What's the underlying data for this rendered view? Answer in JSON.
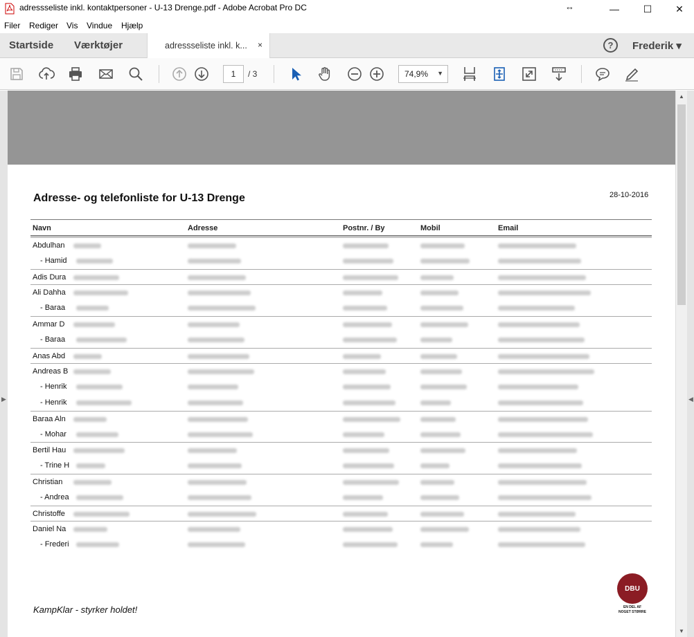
{
  "window": {
    "title": "adressseliste inkl. kontaktpersoner - U-13 Drenge.pdf - Adobe Acrobat Pro DC",
    "minimize": "—",
    "maximize": "☐",
    "close": "✕"
  },
  "menu": [
    "Filer",
    "Rediger",
    "Vis",
    "Vindue",
    "Hjælp"
  ],
  "tabs": {
    "home": "Startside",
    "tools": "Værktøjer",
    "document": "adressseliste inkl. k...",
    "close": "×",
    "help": "?",
    "user": "Frederik ▾"
  },
  "toolbar": {
    "page_current": "1",
    "page_total": "/ 3",
    "zoom": "74,9%",
    "zoom_arrow": "▼",
    "icons": [
      "save-icon",
      "upload-icon",
      "print-icon",
      "mail-icon",
      "search-icon",
      "page-up-icon",
      "page-down-icon",
      "select-arrow-icon",
      "hand-icon",
      "zoom-out-icon",
      "zoom-in-icon",
      "fit-width-icon",
      "fit-page-icon",
      "fullscreen-icon",
      "read-mode-icon",
      "comment-icon",
      "sign-icon"
    ]
  },
  "document": {
    "title": "Adresse- og telefonliste for U-13 Drenge",
    "date": "28-10-2016",
    "columns": [
      "Navn",
      "Adresse",
      "Postnr. / By",
      "Mobil",
      "Email"
    ],
    "rows": [
      {
        "name": "Abdulhan",
        "sub": false
      },
      {
        "name": "- Hamid",
        "sub": true
      },
      {
        "name": "Adis Dura",
        "sub": false
      },
      {
        "name": "Ali Dahha",
        "sub": false
      },
      {
        "name": "- Baraa",
        "sub": true
      },
      {
        "name": "Ammar D",
        "sub": false
      },
      {
        "name": "- Baraa",
        "sub": true
      },
      {
        "name": "Anas Abd",
        "sub": false
      },
      {
        "name": "Andreas B",
        "sub": false
      },
      {
        "name": "- Henrik",
        "sub": true
      },
      {
        "name": "- Henrik",
        "sub": true
      },
      {
        "name": "Baraa Aln",
        "sub": false
      },
      {
        "name": "- Mohar",
        "sub": true
      },
      {
        "name": "Bertil Hau",
        "sub": false
      },
      {
        "name": "- Trine H",
        "sub": true
      },
      {
        "name": "Christian",
        "sub": false
      },
      {
        "name": "- Andrea",
        "sub": true
      },
      {
        "name": "Christoffe",
        "sub": false
      },
      {
        "name": "Daniel Na",
        "sub": false
      },
      {
        "name": "- Frederi",
        "sub": true
      }
    ],
    "footer": "KampKlar - styrker holdet!",
    "logo": {
      "seal": "DBU",
      "line1": "EN DEL AF",
      "line2": "NOGET STØRRE"
    }
  }
}
